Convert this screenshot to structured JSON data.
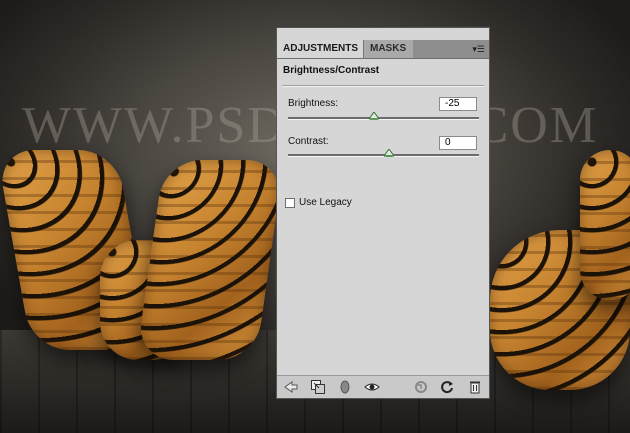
{
  "background": {
    "watermark_text": "WWW.PSD-DUDE.COM"
  },
  "panel": {
    "tabs": [
      {
        "label": "ADJUSTMENTS",
        "active": true
      },
      {
        "label": "MASKS",
        "active": false
      }
    ],
    "title": "Brightness/Contrast",
    "brightness": {
      "label": "Brightness:",
      "value": "-25",
      "slider_fraction": 0.45
    },
    "contrast": {
      "label": "Contrast:",
      "value": "0",
      "slider_fraction": 0.53
    },
    "use_legacy": {
      "label": "Use Legacy",
      "checked": false
    },
    "footer_icons": [
      "back-arrow-icon",
      "clip-to-layer-icon",
      "layer-mask-icon",
      "visibility-eye-icon",
      "view-previous-state-icon",
      "reset-icon",
      "delete-icon"
    ]
  }
}
